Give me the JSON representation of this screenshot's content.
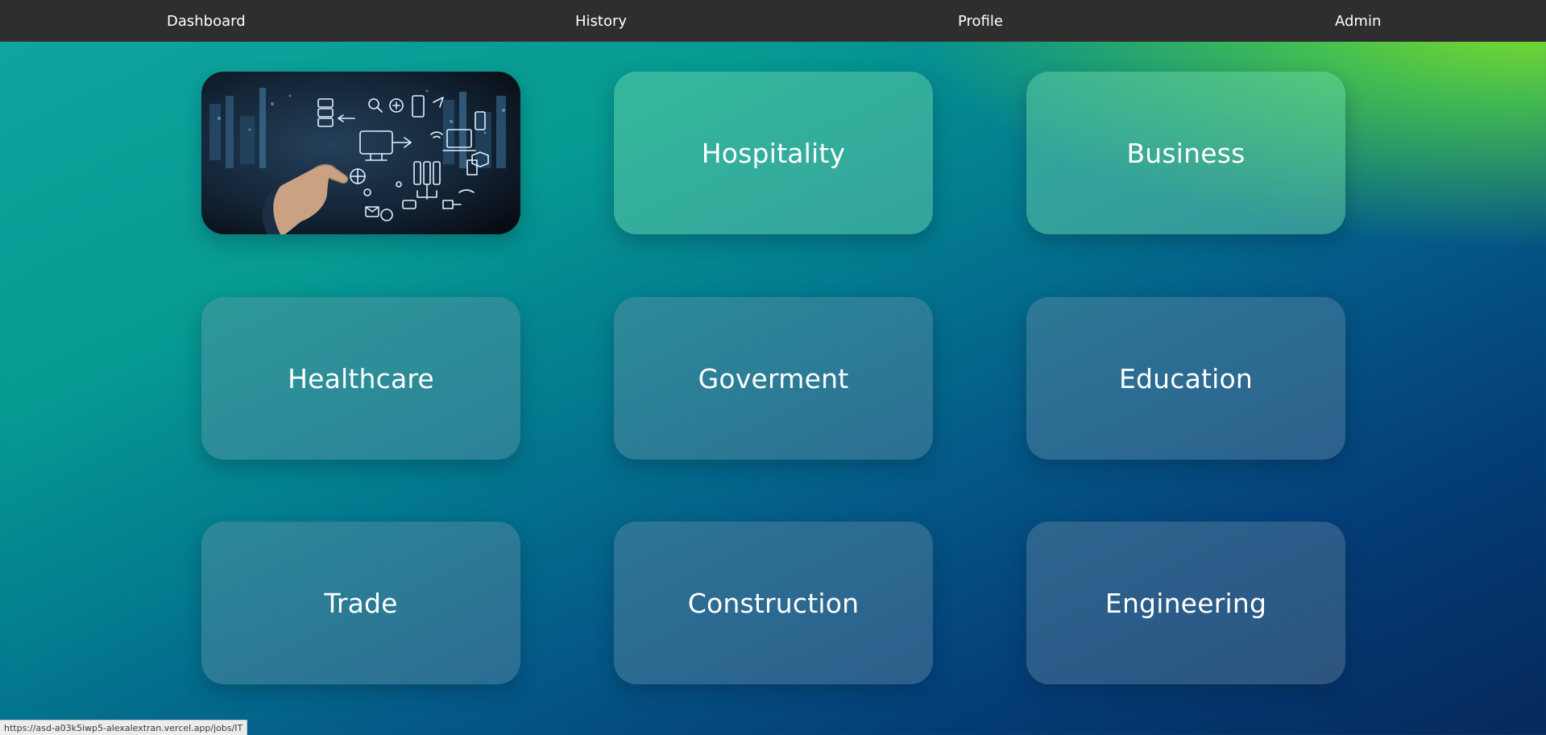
{
  "nav": {
    "items": [
      {
        "label": "Dashboard"
      },
      {
        "label": "History"
      },
      {
        "label": "Profile"
      },
      {
        "label": "Admin"
      }
    ]
  },
  "categories": [
    {
      "label": "IT",
      "image": "technology network illustration"
    },
    {
      "label": "Hospitality"
    },
    {
      "label": "Business"
    },
    {
      "label": "Healthcare"
    },
    {
      "label": "Goverment"
    },
    {
      "label": "Education"
    },
    {
      "label": "Trade"
    },
    {
      "label": "Construction"
    },
    {
      "label": "Engineering"
    }
  ],
  "status_bar": {
    "url": "https://asd-a03k5iwp5-alexalextran.vercel.app/jobs/IT"
  },
  "colors": {
    "nav_bg": "#2e2e2e",
    "accent_green": "#8fe51f",
    "background_teal": "#069a92",
    "background_navy": "#06285a"
  }
}
